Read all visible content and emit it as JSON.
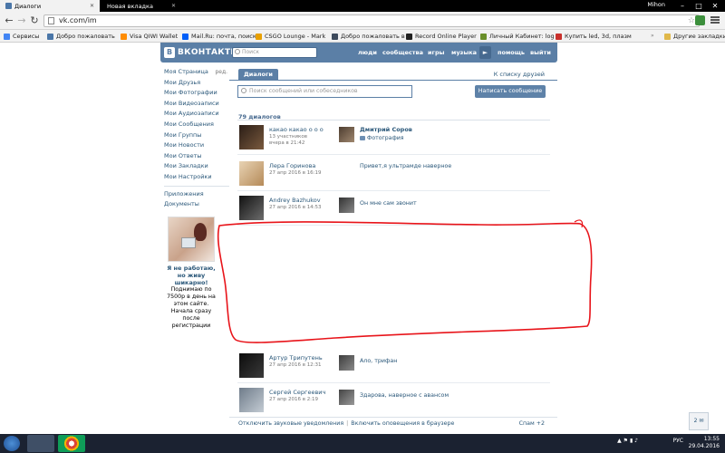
{
  "browser": {
    "tabs": [
      {
        "title": "Диалоги",
        "active": true
      },
      {
        "title": "Новая вкладка",
        "active": false
      }
    ],
    "user": "Mihon",
    "url": "vk.com/im",
    "bookmarks": [
      {
        "label": "Сервисы",
        "color": "#4285f4"
      },
      {
        "label": "Добро пожаловать",
        "color": "#4a76a8"
      },
      {
        "label": "Visa QIWI Wallet",
        "color": "#ff8c00"
      },
      {
        "label": "Mail.Ru: почта, поиск",
        "color": "#005ff9"
      },
      {
        "label": "CSGO Lounge - Mark",
        "color": "#e8a000"
      },
      {
        "label": "Добро пожаловать в",
        "color": "#3d4a5c"
      },
      {
        "label": "Record Online Player",
        "color": "#222222"
      },
      {
        "label": "Личный Кабинет: log",
        "color": "#6a8f2a"
      },
      {
        "label": "Купить led, 3d, плазм",
        "color": "#c9302c"
      }
    ],
    "bookmarks_more": "»",
    "other_bookmarks": "Другие закладки"
  },
  "vk": {
    "logo_text": "ВКОНТАКТЕ",
    "search_placeholder": "Поиск",
    "nav": [
      "люди",
      "сообщества",
      "игры",
      "музыка",
      "помощь",
      "выйти"
    ],
    "left_menu": [
      "Моя Страница",
      "Мои Друзья",
      "Мои Фотографии",
      "Мои Видеозаписи",
      "Мои Аудиозаписи",
      "Мои Сообщения",
      "Мои Группы",
      "Мои Новости",
      "Мои Ответы",
      "Мои Закладки",
      "Мои Настройки"
    ],
    "left_menu_edit": "ред.",
    "left_menu_extra": [
      "Приложения",
      "Документы"
    ],
    "ad": {
      "title": "Я не работаю, но живу шикарно!",
      "text": "Поднимаю по 7500р в день на этом сайте. Начала сразу после регистрации"
    },
    "im": {
      "tab": "Диалоги",
      "to_friends": "К списку друзей",
      "search_placeholder": "Поиск сообщений или собеседников",
      "write_button": "Написать сообщение",
      "count": "79 диалогов",
      "dialogs": [
        {
          "name": "какао какао о о о",
          "sub1": "13 участников",
          "sub2": "вчера в 21:42",
          "msg_author": "Дмитрий Соров",
          "msg_text": "Фотография",
          "avatar": "#3a2a22",
          "msg_avatar": "#6b5a48"
        },
        {
          "name": "Лера Горинова",
          "sub1": "27 апр 2016 в 16:19",
          "sub2": "",
          "msg_author": "",
          "msg_text": "Привет,я ультрамде наверное",
          "avatar": "#caa374",
          "msg_avatar": ""
        },
        {
          "name": "Andrey Bazhukov",
          "sub1": "27 апр 2016 в 14:53",
          "sub2": "",
          "msg_author": "",
          "msg_text": "Он мне сам звонит",
          "avatar": "#2a2a2a",
          "msg_avatar": "#4a4a4a"
        },
        {
          "name": "Артур Трипутень",
          "sub1": "27 апр 2016 в 12:31",
          "sub2": "",
          "msg_author": "",
          "msg_text": "Ало, трифан",
          "avatar": "#1f1f1f",
          "msg_avatar": "#5a5a5a"
        },
        {
          "name": "Сергей Сергеевич",
          "sub1": "27 апр 2016 в 2:19",
          "sub2": "",
          "msg_author": "",
          "msg_text": "Здарова, наверное с авансом",
          "avatar": "#8d9aa8",
          "msg_avatar": "#6a6a6a"
        }
      ],
      "footer_sound": "Отключить звуковые уведомления",
      "footer_notify": "Включить оповещения в браузере",
      "spam": "Спам +2"
    },
    "corner_badge": "2"
  },
  "taskbar": {
    "tray_lang": "РУС",
    "time": "13:55",
    "date": "29.04.2016"
  }
}
